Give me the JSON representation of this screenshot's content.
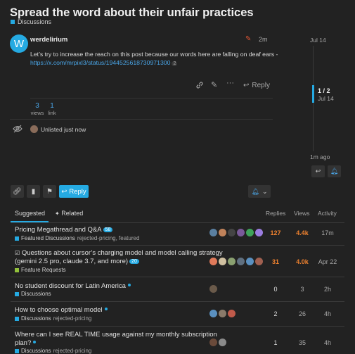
{
  "topic": {
    "title": "Spread the word about their unfair practices",
    "category": "Discussions",
    "category_color": "#25AAE2"
  },
  "post": {
    "avatar_letter": "W",
    "username": "werdelirium",
    "edit_count": "",
    "time": "2m",
    "text": "Let’s try to increase the reach on this post because our words here are falling on deaf ears -",
    "link": "https://x.com/mrpixl3/status/1944525618730971300",
    "link_clicks": "2",
    "reply_label": "Reply",
    "views_count": "3",
    "views_label": "views",
    "links_count": "1",
    "links_label": "link",
    "unlisted_text": "Unlisted just now"
  },
  "timeline": {
    "top_date": "Jul 14",
    "position": "1 / 2",
    "position_date": "Jul 14",
    "bottom_date": "1m ago"
  },
  "footer": {
    "reply_label": "Reply"
  },
  "suggested": {
    "tabs": [
      "Suggested",
      "Related"
    ],
    "headers": {
      "replies": "Replies",
      "views": "Views",
      "activity": "Activity"
    },
    "topics": [
      {
        "title": "Pricing Megathread and Q&A",
        "badge": "58",
        "category": "Featured Discussions",
        "cat_color": "#25AAE2",
        "tags": "rejected-pricing, featured",
        "replies": "127",
        "views": "4.4k",
        "activity": "17m",
        "hot_replies": true,
        "hot_views": true,
        "poster_colors": [
          "#5a7fa0",
          "#c0825a",
          "#3a3a3a",
          "#7a5a9a",
          "#3fa35a",
          "#9b7de0"
        ]
      },
      {
        "title": "Questions about cursor’s charging model and model calling strategy",
        "title2": "(gemini 2.5 pro, claude 3.7, and more)",
        "badge": "20",
        "category": "Feature Requests",
        "cat_color": "#92C13B",
        "tags": "",
        "replies": "31",
        "views": "4.0k",
        "activity": "Apr 22",
        "hot_replies": true,
        "hot_views": true,
        "poster_colors": [
          "#e07a5a",
          "#d0c0a0",
          "#8aa070",
          "#607080",
          "#5a90c0",
          "#a06050"
        ]
      },
      {
        "title": "No student discount for Latin America",
        "category": "Discussions",
        "cat_color": "#25AAE2",
        "tags": "",
        "replies": "0",
        "views": "3",
        "activity": "2h",
        "poster_colors": [
          "#6a5a4a"
        ]
      },
      {
        "title": "How to choose optimal model",
        "category": "Discussions",
        "cat_color": "#25AAE2",
        "tags": "rejected-pricing",
        "replies": "2",
        "views": "26",
        "activity": "4h",
        "poster_colors": [
          "#5a90c0",
          "#8a7a6a",
          "#c05a4a"
        ]
      },
      {
        "title": "Where can I see REAL TIME usage against my monthly subscription",
        "title2": "plan?",
        "category": "Discussions",
        "cat_color": "#25AAE2",
        "tags": "rejected-pricing",
        "replies": "1",
        "views": "35",
        "activity": "4h",
        "poster_colors": [
          "#6a4a3a",
          "#8a8a8a"
        ]
      }
    ]
  }
}
